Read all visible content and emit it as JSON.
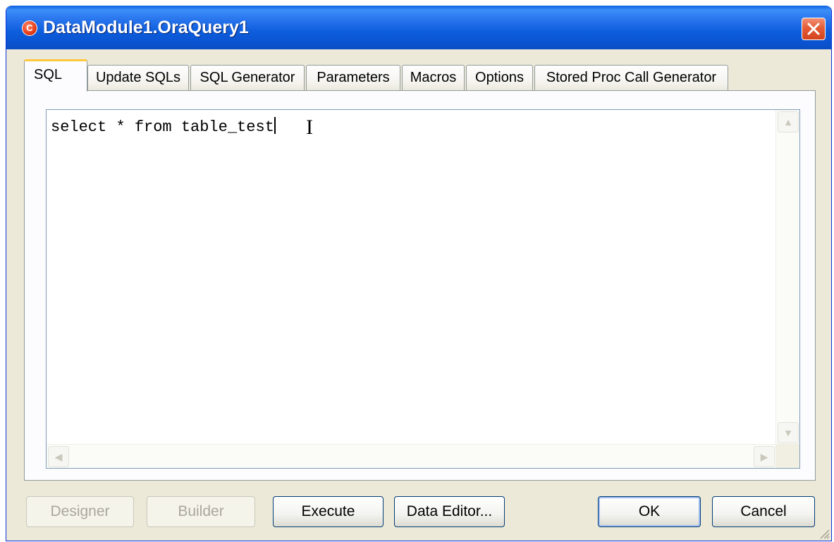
{
  "window": {
    "title": "DataModule1.OraQuery1",
    "icon": "app-logo-icon",
    "accent": "#0a5fe0"
  },
  "tabs": [
    {
      "label": "SQL",
      "active": true
    },
    {
      "label": "Update SQLs",
      "active": false
    },
    {
      "label": "SQL Generator",
      "active": false
    },
    {
      "label": "Parameters",
      "active": false
    },
    {
      "label": "Macros",
      "active": false
    },
    {
      "label": "Options",
      "active": false
    },
    {
      "label": "Stored Proc Call Generator",
      "active": false
    }
  ],
  "editor": {
    "sql_text": "select * from table_test"
  },
  "buttons": {
    "designer": "Designer",
    "builder": "Builder",
    "execute": "Execute",
    "data_editor": "Data Editor...",
    "ok": "OK",
    "cancel": "Cancel"
  }
}
